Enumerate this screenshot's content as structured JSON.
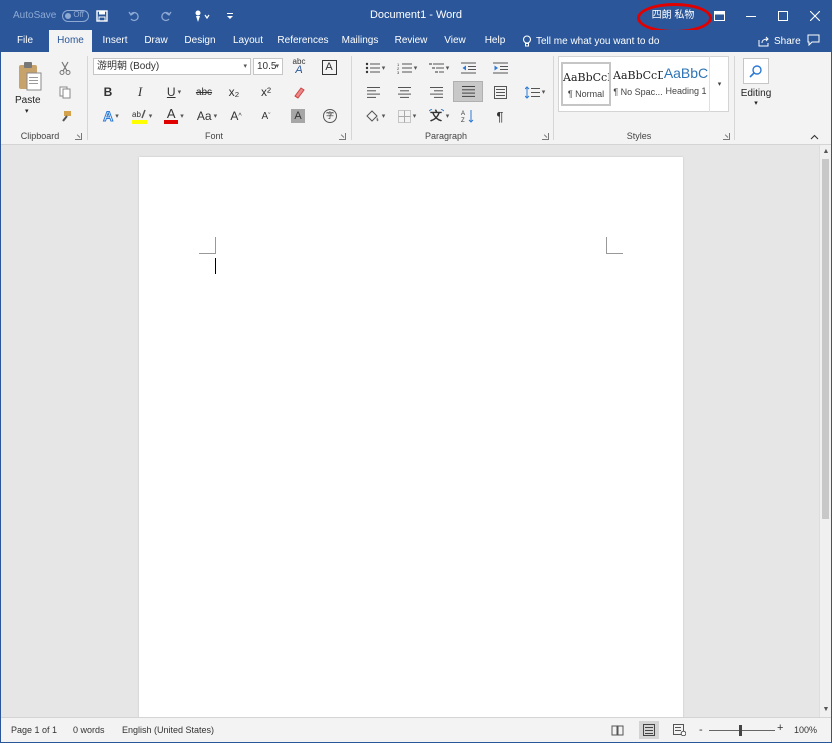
{
  "title_bar": {
    "autosave_label": "AutoSave",
    "autosave_state": "Off",
    "document_title": "Document1  -  Word",
    "user_name": "四朗 私物",
    "icons": [
      "save-icon",
      "undo-icon",
      "redo-icon",
      "touch-mode-icon",
      "customize-qat-icon",
      "ribbon-display-icon",
      "minimize-icon",
      "maximize-icon",
      "close-icon"
    ]
  },
  "tabs": [
    {
      "label": "File"
    },
    {
      "label": "Home"
    },
    {
      "label": "Insert"
    },
    {
      "label": "Draw"
    },
    {
      "label": "Design"
    },
    {
      "label": "Layout"
    },
    {
      "label": "References"
    },
    {
      "label": "Mailings"
    },
    {
      "label": "Review"
    },
    {
      "label": "View"
    },
    {
      "label": "Help"
    }
  ],
  "active_tab": "Home",
  "tell_me": "Tell me what you want to do",
  "share_label": "Share",
  "ribbon": {
    "clipboard": {
      "label": "Clipboard",
      "paste_label": "Paste"
    },
    "font": {
      "label": "Font",
      "font_name": "游明朝 (Body)",
      "font_size": "10.5",
      "bold": "B",
      "italic": "I",
      "underline": "U",
      "strike": "abc",
      "subscript": "x₂",
      "superscript": "x²",
      "change_case": "Aa",
      "grow": "A",
      "shrink": "A",
      "phonetic": "abc",
      "char_border": "A",
      "shading": "A",
      "enclose": "字"
    },
    "paragraph": {
      "label": "Paragraph"
    },
    "styles": {
      "label": "Styles",
      "items": [
        {
          "sample": "AaBbCcD",
          "name": "¶ Normal"
        },
        {
          "sample": "AaBbCcD",
          "name": "¶ No Spac..."
        },
        {
          "sample": "AaBbC",
          "name": "Heading 1"
        }
      ]
    },
    "editing": {
      "label": "Editing"
    }
  },
  "status_bar": {
    "page": "Page 1 of 1",
    "words": "0 words",
    "language": "English (United States)",
    "zoom_minus": "-",
    "zoom_plus": "+",
    "zoom": "100%"
  },
  "colors": {
    "brand": "#2b579a",
    "highlight_yellow": "#ffff00",
    "font_red": "#e00000",
    "annotation_oval": "#e00000"
  }
}
